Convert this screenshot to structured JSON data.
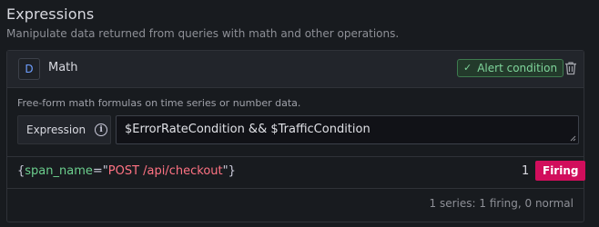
{
  "section": {
    "title": "Expressions",
    "subtitle": "Manipulate data returned from queries with math and other operations."
  },
  "query": {
    "ref_id": "D",
    "name": "Math",
    "alert_condition_label": "Alert condition",
    "description": "Free-form math formulas on time series or number data.",
    "expression_label": "Expression",
    "expression_value": "$ErrorRateCondition && $TrafficCondition"
  },
  "result": {
    "open_brace": "{",
    "label_key": "span_name",
    "equals_quote": "=\"",
    "label_value": "POST /api/checkout",
    "close": "\"}",
    "value": "1",
    "state": "Firing",
    "summary": "1 series: 1 firing, 0 normal"
  },
  "colors": {
    "background": "#181b1f",
    "alert_condition_green": "#7fd59b",
    "firing_badge": "#d10e5c",
    "label_key": "#6ccf8e",
    "label_value": "#ff7383",
    "ref_id_blue": "#6e9fff"
  },
  "icons": {
    "check": "check-icon",
    "trash": "trash-icon",
    "info": "info-icon"
  }
}
